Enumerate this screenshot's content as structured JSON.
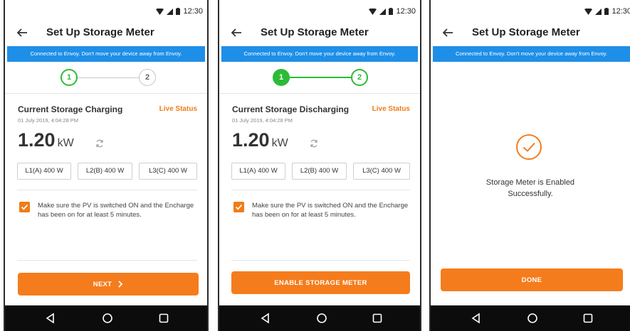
{
  "colors": {
    "accent": "#f57c1c",
    "banner": "#1e8fe8",
    "step_green": "#2dbb37",
    "nav_bar": "#0c0c0c"
  },
  "status_bar": {
    "time": "12:30",
    "icons": [
      "wifi-icon",
      "cellular-signal-icon",
      "battery-icon"
    ]
  },
  "screens": [
    {
      "title": "Set Up Storage Meter",
      "banner": "Connected to Envoy. Don't move your device away from Envoy.",
      "stepper": {
        "step1": "1",
        "step2": "2",
        "current_step": 1
      },
      "section_title": "Current Storage Charging",
      "live_status": "Live Status",
      "timestamp": "01 July 2019, 4:04:28 PM",
      "power_value": "1.20",
      "power_unit": "kW",
      "phases": [
        "L1(A) 400 W",
        "L2(B) 400 W",
        "L3(C) 400 W"
      ],
      "checkbox_checked": true,
      "checkbox_text": "Make sure the PV is switched ON and the Encharge has been on for at least 5 minutes.",
      "button": "NEXT",
      "button_icon": "chevron-right-icon"
    },
    {
      "title": "Set Up Storage Meter",
      "banner": "Connected to Envoy. Don't move your device away from Envoy.",
      "stepper": {
        "step1": "1",
        "step2": "2",
        "current_step": 2
      },
      "section_title": "Current Storage Discharging",
      "live_status": "Live Status",
      "timestamp": "01 July 2019, 4:04:28 PM",
      "power_value": "1.20",
      "power_unit": "kW",
      "phases": [
        "L1(A) 400 W",
        "L2(B) 400 W",
        "L3(C) 400 W"
      ],
      "checkbox_checked": true,
      "checkbox_text": "Make sure the PV is switched ON and the Encharge has been on for at least 5 minutes.",
      "button": "ENABLE STORAGE METER"
    },
    {
      "title": "Set Up Storage Meter",
      "banner": "Connected to Envoy. Don't move your device away from Envoy.",
      "success_icon": "checkmark-circle-icon",
      "success_line1": "Storage Meter is Enabled",
      "success_line2": "Successfully.",
      "button": "DONE"
    }
  ],
  "nav_buttons": [
    "back-triangle-icon",
    "home-circle-icon",
    "recents-square-icon"
  ]
}
